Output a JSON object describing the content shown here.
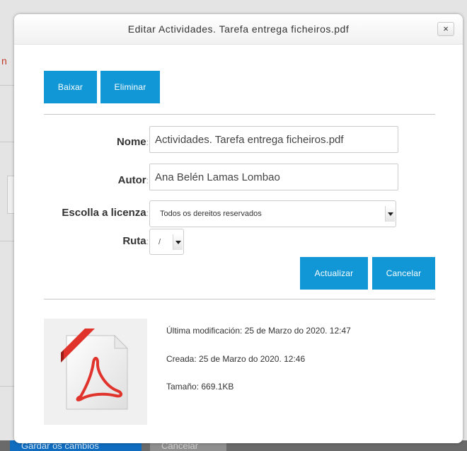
{
  "background": {
    "save_button_label": "Gardar os cambios",
    "cancel_button_label": "Cancelar",
    "red_fragment": "n"
  },
  "dialog": {
    "title": "Editar Actividades. Tarefa entrega ficheiros.pdf",
    "close_label": "×",
    "download_label": "Baixar",
    "delete_label": "Eliminar",
    "fields": {
      "name_label": "Nome",
      "name_value": "Actividades. Tarefa entrega ficheiros.pdf",
      "author_label": "Autor",
      "author_value": "Ana Belén Lamas Lombao",
      "license_label": "Escolla a licenza",
      "license_value": "Todos os dereitos reservados",
      "path_label": "Ruta",
      "path_value": "/",
      "colon": ":"
    },
    "update_label": "Actualizar",
    "cancel_label": "Cancelar",
    "file_info": {
      "modified": "Última modificación: 25 de Marzo do 2020. 12:47",
      "created": "Creada: 25 de Marzo do 2020. 12:46",
      "size": "Tamaño: 669.1KB"
    },
    "file_icon": "pdf-file-icon"
  },
  "colors": {
    "accent": "#1197d6",
    "pdf_red": "#e0332b"
  }
}
